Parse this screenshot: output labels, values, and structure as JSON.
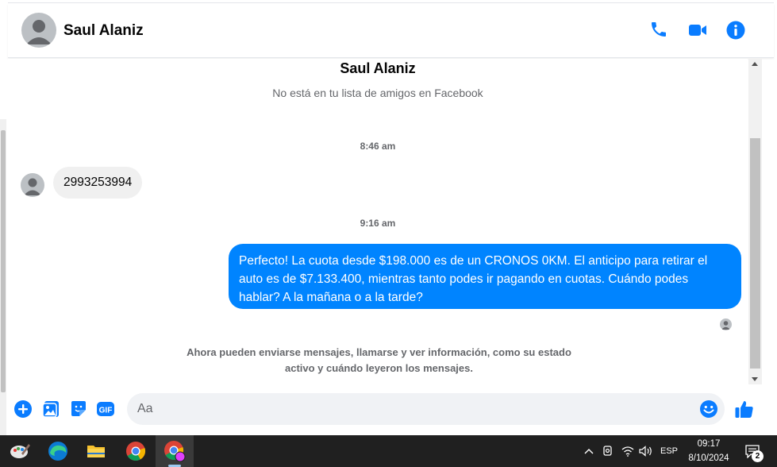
{
  "header": {
    "contact_name": "Saul Alaniz",
    "icons": [
      "phone-icon",
      "video-call-icon",
      "info-icon"
    ]
  },
  "conversation": {
    "profile_name": "Saul Alaniz",
    "profile_subtitle": "No está en tu lista de amigos en Facebook",
    "messages": [
      {
        "timestamp": "8:46 am",
        "direction": "incoming",
        "text": "2993253994"
      },
      {
        "timestamp": "9:16 am",
        "direction": "outgoing",
        "text": "Perfecto! La cuota desde $198.000 es de un CRONOS 0KM. El anticipo para retirar el auto es de $7.133.400, mientras tanto podes ir pagando en cuotas. Cuándo podes hablar? A la mañana o a la tarde?"
      }
    ],
    "info_note": "Ahora pueden enviarse mensajes, llamarse y ver información, como su estado activo y cuándo leyeron los mensajes."
  },
  "composer": {
    "placeholder": "Aa",
    "value": "",
    "icons": [
      "plus-icon",
      "photo-icon",
      "sticker-icon",
      "gif-icon",
      "emoji-icon",
      "like-icon"
    ],
    "gif_label": "GIF"
  },
  "taskbar": {
    "apps": [
      "paint-app-icon",
      "edge-browser-icon",
      "file-explorer-icon",
      "chrome-browser-icon",
      "chrome-profile-icon"
    ],
    "language": "ESP",
    "time": "09:17",
    "date": "8/10/2024",
    "notification_count": "2"
  },
  "colors": {
    "accent": "#0084ff",
    "icon_blue": "#0a7cff",
    "incoming_bubble": "#f0f0f0",
    "muted_text": "#65676b",
    "taskbar": "#202020"
  }
}
